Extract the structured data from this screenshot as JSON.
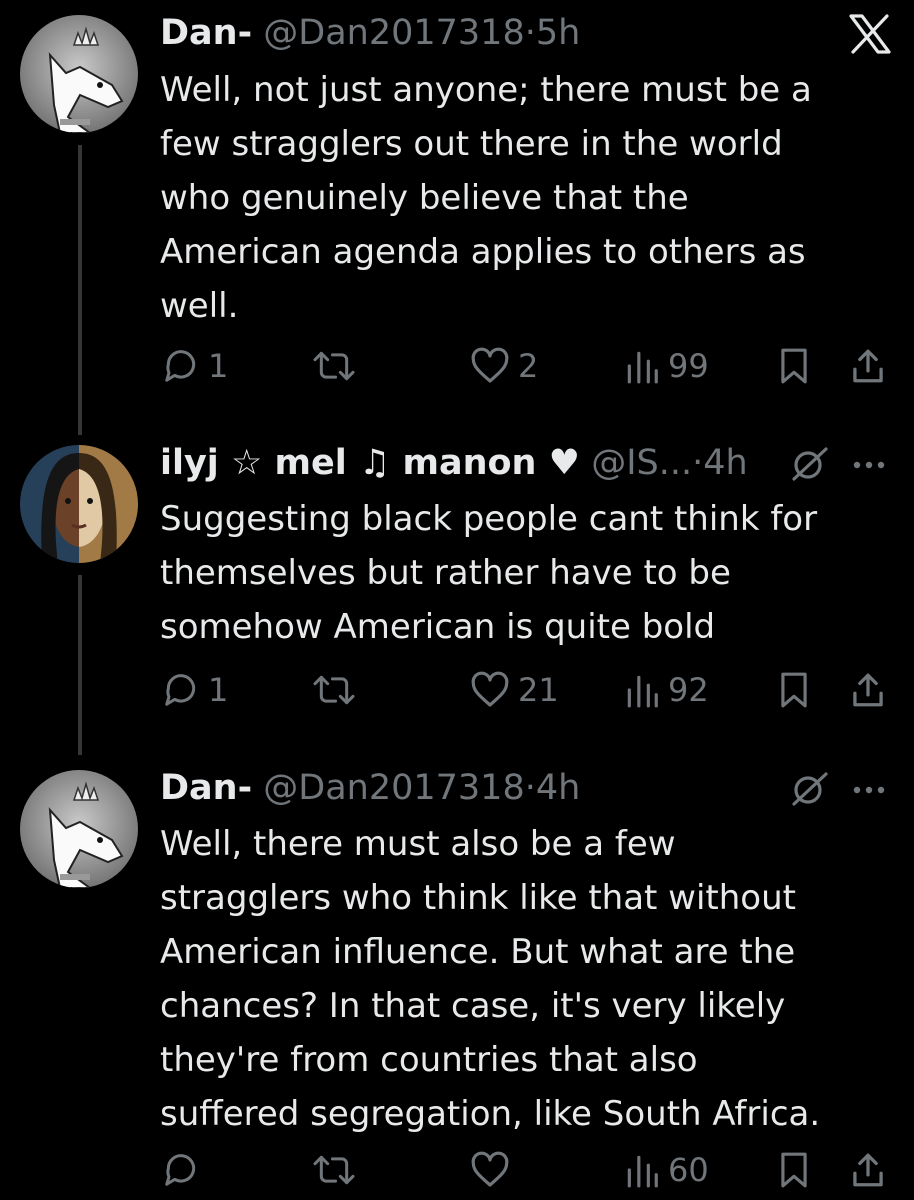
{
  "thread": [
    {
      "author_name": "Dan-",
      "handle": "@Dan2017318",
      "separator": "·",
      "time": "5h",
      "text": "Well, not just anyone; there must be a\nfew stragglers out there in the world\nwho genuinely believe that the\nAmerican agenda applies to others as\nwell.",
      "replies": "1",
      "reposts": "",
      "likes": "2",
      "views": "99",
      "top_right_icon": "x-logo-icon"
    },
    {
      "author_name": "ilyj ☆ mel ♫ manon ♥",
      "handle": "@IS...",
      "separator": "·",
      "time": "4h",
      "text": "Suggesting black people cant think for\nthemselves but rather have to be\nsomehow American is quite bold",
      "replies": "1",
      "reposts": "",
      "likes": "21",
      "views": "92",
      "top_right_icon": "grok-icon"
    },
    {
      "author_name": "Dan-",
      "handle": "@Dan2017318",
      "separator": "·",
      "time": "4h",
      "text": "Well, there must also be a few\nstragglers who think like that without\nAmerican influence. But what are the\nchances? In that case, it's very likely\nthey're from countries that also\nsuffered segregation, like South Africa.",
      "replies": "",
      "reposts": "",
      "likes": "",
      "views": "60",
      "top_right_icon": "grok-icon"
    }
  ],
  "colors": {
    "background": "#000000",
    "text": "#e7e9ea",
    "muted": "#71767b",
    "thread_line": "#333639"
  }
}
